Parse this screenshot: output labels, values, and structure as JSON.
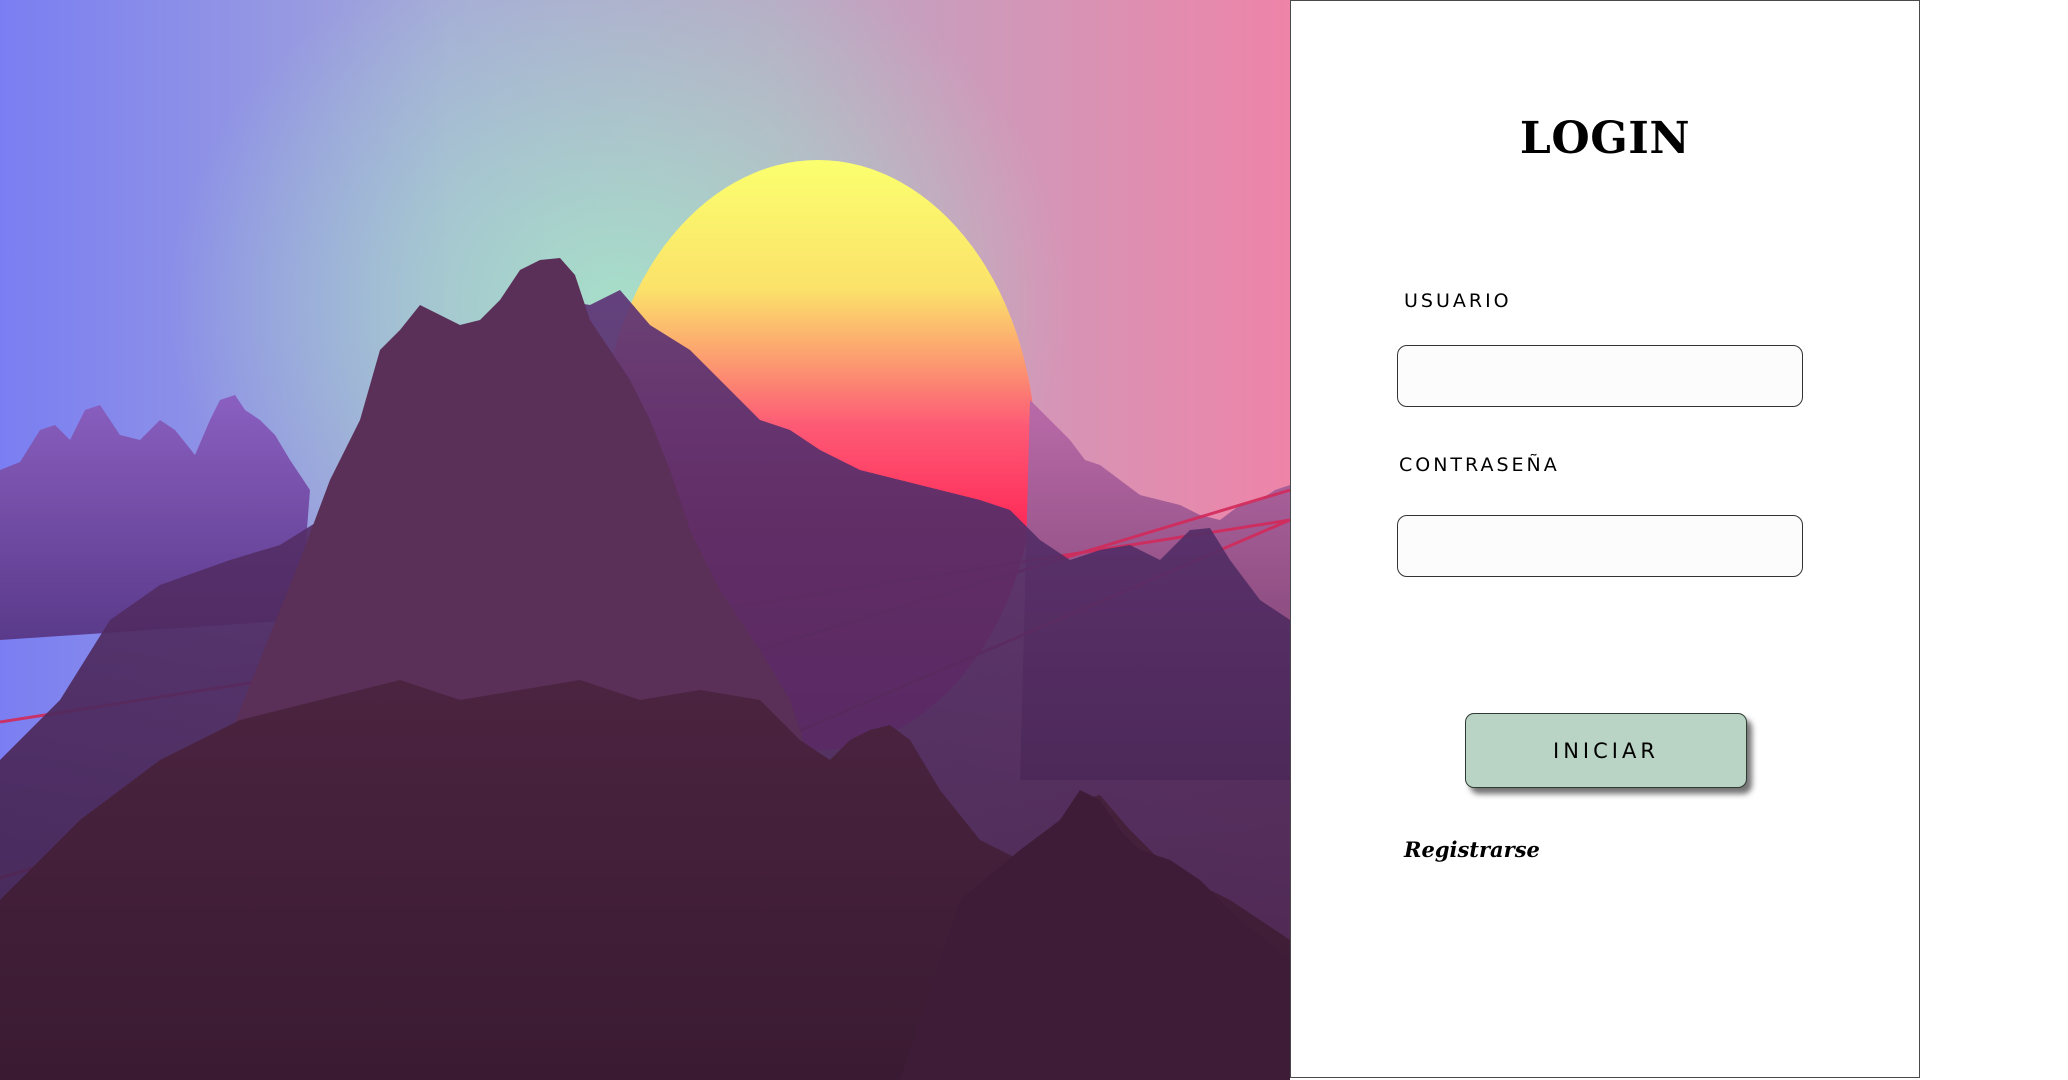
{
  "login": {
    "title": "LOGIN",
    "username_label": "USUARIO",
    "username_value": "",
    "password_label": "CONTRASEÑA",
    "password_value": "",
    "submit_label": "INICIAR",
    "register_label": "Registrarse"
  },
  "colors": {
    "button_background": "#b9d4c4",
    "panel_background": "#ffffff",
    "input_background": "#fdfcfd"
  },
  "hero": {
    "description_icon": "synthwave-mountains-sunset"
  }
}
